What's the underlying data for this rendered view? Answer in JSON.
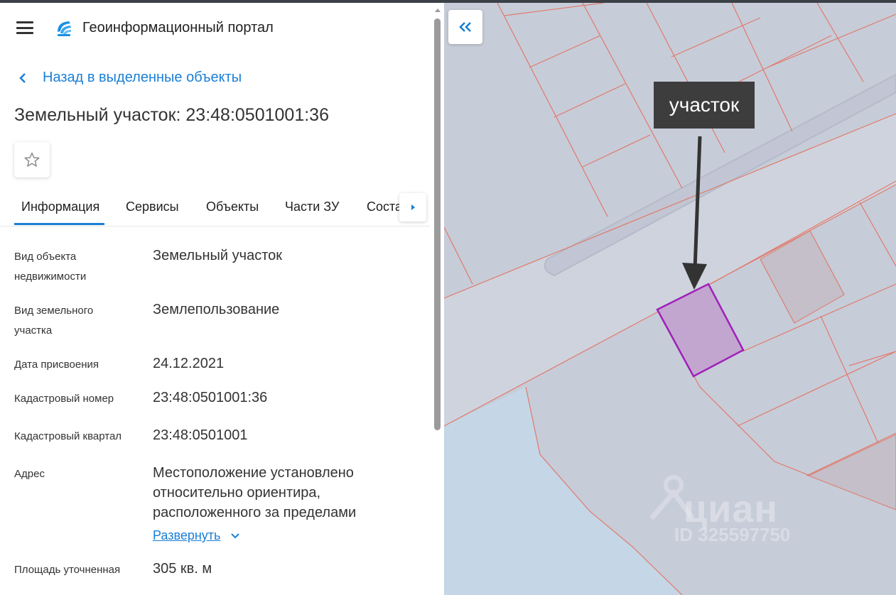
{
  "header": {
    "title": "Геоинформационный портал"
  },
  "nav": {
    "back_label": "Назад в выделенные объекты"
  },
  "object": {
    "title": "Земельный участок: 23:48:0501001:36"
  },
  "tabs": [
    {
      "label": "Информация"
    },
    {
      "label": "Сервисы"
    },
    {
      "label": "Объекты"
    },
    {
      "label": "Части ЗУ"
    },
    {
      "label": "Соста"
    }
  ],
  "properties": {
    "object_type": {
      "label_line1": "Вид объекта",
      "label_line2": "недвижимости",
      "value": "Земельный участок"
    },
    "land_type": {
      "label_line1": "Вид земельного",
      "label_line2": "участка",
      "value": "Землепользование"
    },
    "assign_date": {
      "label": "Дата присвоения",
      "value": "24.12.2021"
    },
    "cadastral_number": {
      "label": "Кадастровый номер",
      "value": "23:48:0501001:36"
    },
    "cadastral_quarter": {
      "label": "Кадастровый квартал",
      "value": "23:48:0501001"
    },
    "address": {
      "label": "Адрес",
      "line1": "Местоположение установлено",
      "line2": "относительно ориентира,",
      "line3": "расположенного за пределами",
      "expand_label": "Развернуть"
    },
    "area": {
      "label": "Площадь уточненная",
      "value": "305 кв. м"
    }
  },
  "map": {
    "callout_label": "участок",
    "watermark_brand": "циан",
    "watermark_id": "ID 325597750",
    "colors": {
      "land": "#c7ccd9",
      "water": "#c5d6e6",
      "parcel_border": "#e07a6a",
      "highlight_fill": "#c2a6d0",
      "highlight_border": "#a020b8",
      "accent": "#1a7fd6"
    }
  }
}
